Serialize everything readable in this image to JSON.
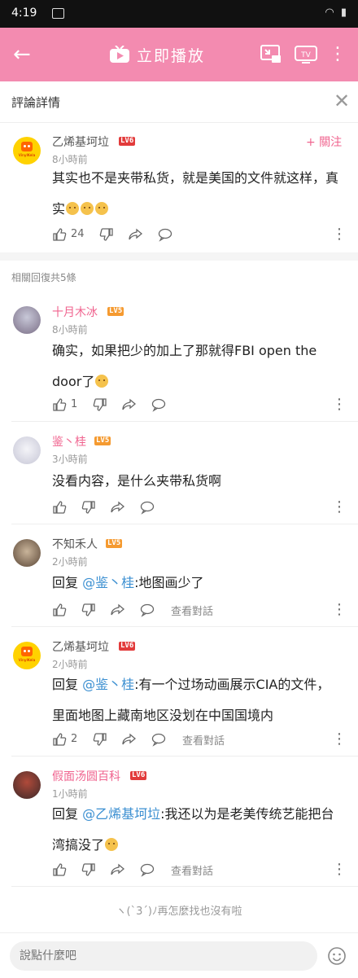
{
  "status_bar": {
    "time": "4:19",
    "system_icons": "◠ ▮"
  },
  "app_bar": {
    "back": "←",
    "play_label": "立即播放",
    "more": "⋮"
  },
  "sub_header": {
    "title": "評論詳情",
    "close": "✕"
  },
  "main_comment": {
    "username": "乙烯基坷垃",
    "level": "LV6",
    "time": "8小時前",
    "follow_label": "+ 關注",
    "text": "其实也不是夹带私货，就是美国的文件就这样，真实",
    "emoji_count": 3,
    "likes": "24",
    "avatar_text": "VinylKela"
  },
  "replies_header": "相關回復共5條",
  "replies": [
    {
      "username": "十月木冰",
      "level": "LV5",
      "time": "8小時前",
      "text_line1": "确实，如果把少的加上了那就得FBI open the",
      "text_line2": "door了",
      "likes": "1"
    },
    {
      "username": "鉴丶桂",
      "level": "LV5",
      "time": "3小時前",
      "text": "没看内容，是什么夹带私货啊"
    },
    {
      "username": "不知禾人",
      "level": "LV5",
      "time": "2小時前",
      "reply_prefix": "回复",
      "mention": "@鉴丶桂",
      "text": ":地图画少了",
      "view_conversation": "查看對話"
    },
    {
      "username": "乙烯基坷垃",
      "level": "LV6",
      "time": "2小時前",
      "reply_prefix": "回复",
      "mention": "@鉴丶桂",
      "text_line1": ":有一个过场动画展示CIA的文件，",
      "text_line2": "里面地图上藏南地区没划在中国国境内",
      "likes": "2",
      "view_conversation": "查看對話"
    },
    {
      "username": "假面汤圆百科",
      "level": "LV6",
      "time": "1小時前",
      "reply_prefix": "回复",
      "mention": "@乙烯基坷垃",
      "text_line1": ":我还以为是老美传统艺能把台",
      "text_line2": "湾搞没了",
      "view_conversation": "查看對話"
    }
  ],
  "end_message": "ヽ(`3´)ﾉ再怎麼找也沒有啦",
  "input": {
    "placeholder": "說點什麼吧"
  },
  "colors": {
    "accent_pink": "#f38bb0",
    "name_pink": "#f0648f",
    "mention_blue": "#3b8fd1",
    "lv6": "#e23b3b",
    "lv5": "#f59a30"
  }
}
